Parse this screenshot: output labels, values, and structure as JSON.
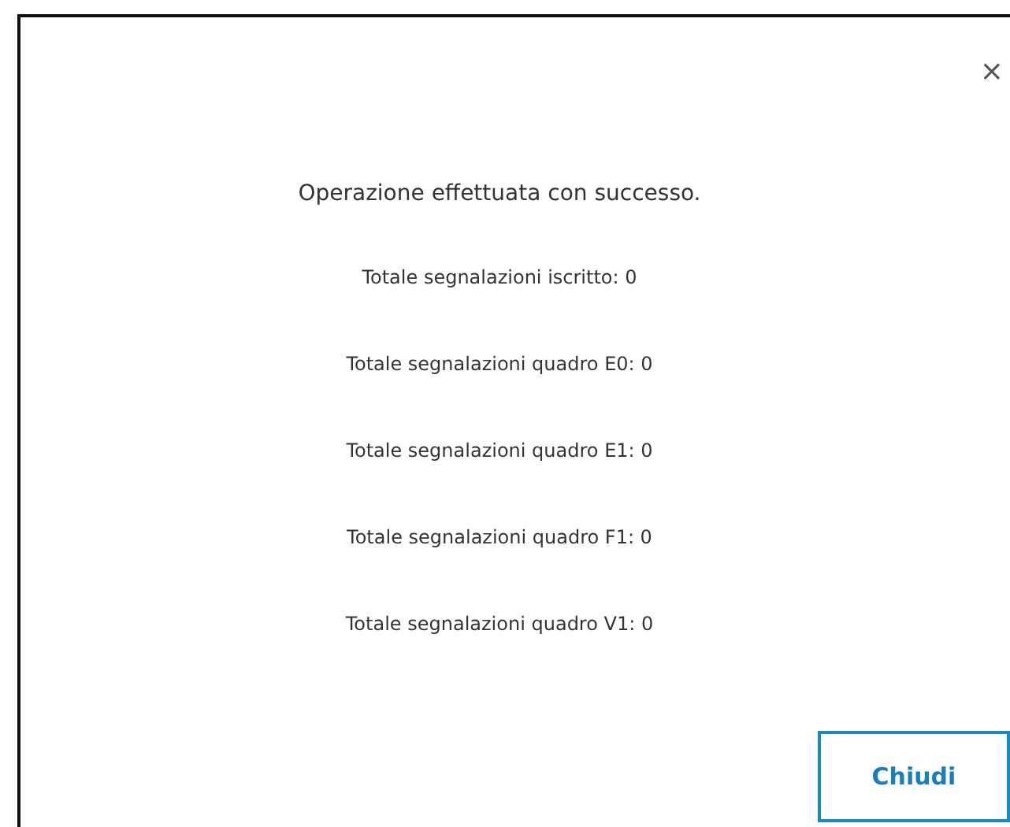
{
  "dialog": {
    "close": "×",
    "message": "Operazione effettuata con successo.",
    "totals": [
      "Totale segnalazioni iscritto: 0",
      "Totale segnalazioni quadro E0: 0",
      "Totale segnalazioni quadro E1: 0",
      "Totale segnalazioni quadro F1: 0",
      "Totale segnalazioni quadro V1: 0"
    ],
    "button": "Chiudi"
  }
}
